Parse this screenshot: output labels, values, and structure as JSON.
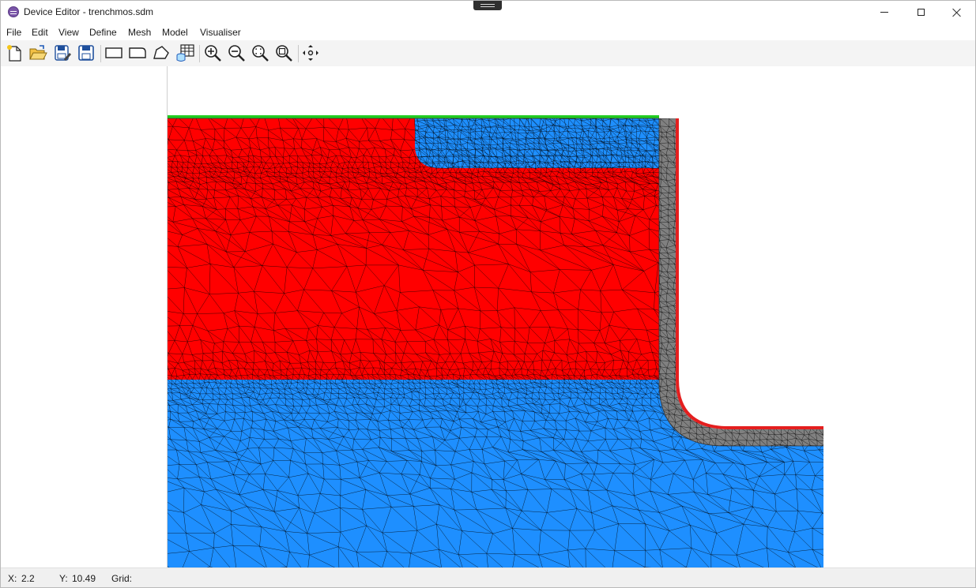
{
  "window": {
    "title": "Device Editor - trenchmos.sdm"
  },
  "menu": [
    "File",
    "Edit",
    "View",
    "Define",
    "Mesh",
    "Model",
    "Visualiser"
  ],
  "toolbar": {
    "icons": [
      "new-file-icon",
      "open-folder-icon",
      "save-as-icon",
      "save-icon",
      "rectangle-tool-icon",
      "rounded-rectangle-tool-icon",
      "polygon-tool-icon",
      "region-table-icon",
      "zoom-in-icon",
      "zoom-out-icon",
      "zoom-fit-icon",
      "zoom-extent-icon",
      "pan-icon"
    ]
  },
  "status": {
    "x_label": "X:",
    "x_value": "2.2",
    "y_label": "Y:",
    "y_value": "10.49",
    "grid_label": "Grid:"
  },
  "colors": {
    "p_region": "#ff0000",
    "n_region": "#1e8fff",
    "oxide": "#808080",
    "contact_top": "#22cc22",
    "gate": "#e41f1f",
    "mesh_line": "#000000"
  }
}
